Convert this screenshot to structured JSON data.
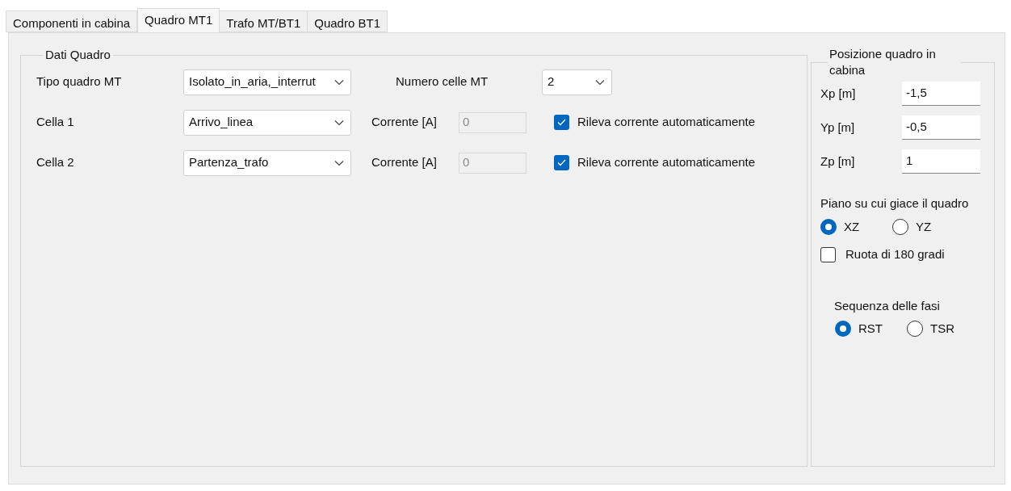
{
  "tabs": [
    {
      "label": "Componenti in cabina",
      "selected": false
    },
    {
      "label": "Quadro MT1",
      "selected": true
    },
    {
      "label": "Trafo MT/BT1",
      "selected": false
    },
    {
      "label": "Quadro BT1",
      "selected": false
    }
  ],
  "dati_quadro": {
    "title": "Dati Quadro",
    "tipo_quadro": {
      "label": "Tipo quadro MT",
      "value": "Isolato_in_aria,_interrut"
    },
    "numero_celle": {
      "label": "Numero celle MT",
      "value": "2"
    },
    "celle": [
      {
        "label": "Cella 1",
        "value": "Arrivo_linea",
        "corrente_label": "Corrente [A]",
        "corrente_value": "0",
        "corrente_disabled": true,
        "auto_label": "Rileva corrente automaticamente",
        "auto_checked": true
      },
      {
        "label": "Cella 2",
        "value": "Partenza_trafo",
        "corrente_label": "Corrente [A]",
        "corrente_value": "0",
        "corrente_disabled": true,
        "auto_label": "Rileva corrente automaticamente",
        "auto_checked": true
      }
    ]
  },
  "posizione": {
    "title": "Posizione quadro in cabina",
    "coords": [
      {
        "label": "Xp [m]",
        "value": "-1,5"
      },
      {
        "label": "Yp [m]",
        "value": "-0,5"
      },
      {
        "label": "Zp [m]",
        "value": "1"
      }
    ],
    "piano": {
      "label": "Piano su cui giace il quadro",
      "options": [
        {
          "label": "XZ",
          "selected": true
        },
        {
          "label": "YZ",
          "selected": false
        }
      ]
    },
    "ruota": {
      "label": "Ruota di 180 gradi",
      "checked": false
    },
    "sequenza": {
      "label": "Sequenza delle fasi",
      "options": [
        {
          "label": "RST",
          "selected": true
        },
        {
          "label": "TSR",
          "selected": false
        }
      ]
    }
  }
}
